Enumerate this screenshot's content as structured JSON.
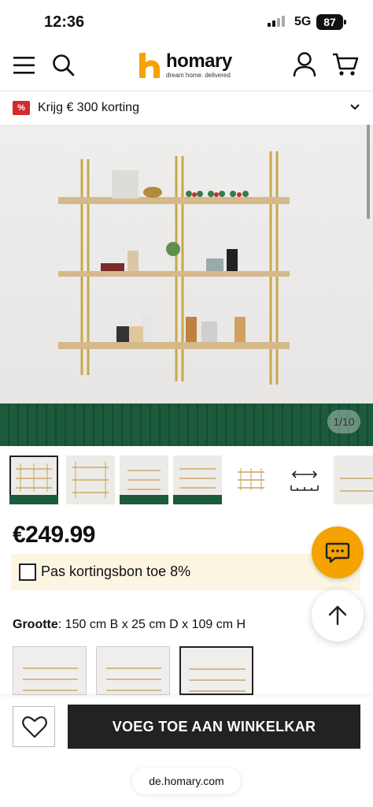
{
  "status_bar": {
    "time": "12:36",
    "network": "5G",
    "battery": "87"
  },
  "header": {
    "brand": "homary",
    "tagline": "dream home. delivered",
    "icons": [
      "menu-icon",
      "search-icon",
      "account-icon",
      "cart-icon"
    ]
  },
  "promo": {
    "badge": "%",
    "text": "Krijg € 300 korting"
  },
  "gallery": {
    "counter": "1/10",
    "thumbnail_count": 7,
    "selected_index": 0
  },
  "product": {
    "price": "€249.99",
    "coupon_label": "Pas kortingsbon toe 8%",
    "coupon_checked": false,
    "size_label": "Grootte",
    "size_value": ": 150 cm B x 25 cm D x 109 cm H",
    "size_option_count": 3,
    "selected_size_index": 2
  },
  "actions": {
    "add_to_cart": "VOEG TOE AAN WINKELKAR"
  },
  "browser": {
    "url": "de.homary.com"
  },
  "colors": {
    "accent": "#f5a300",
    "promo_red": "#d42a2a",
    "dark": "#222222",
    "green_wall": "#1c5a3c",
    "coupon_bg": "#fbf5e2"
  }
}
